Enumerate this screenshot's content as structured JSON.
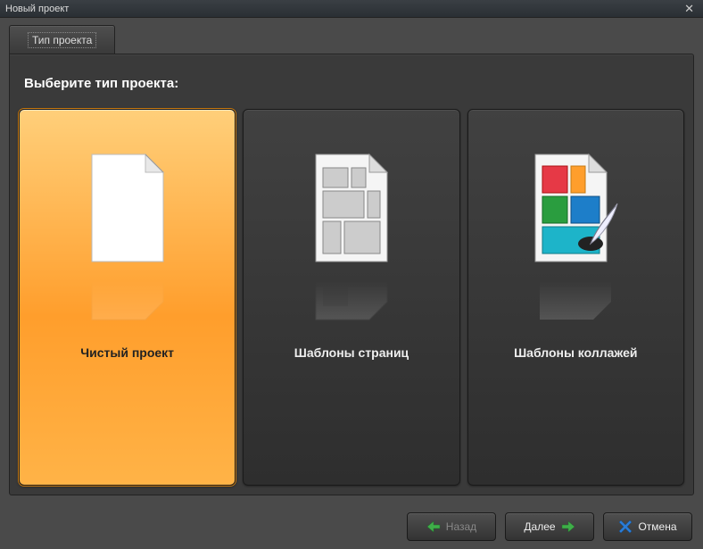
{
  "window": {
    "title": "Новый проект"
  },
  "tab": {
    "label": "Тип проекта"
  },
  "prompt": "Выберите тип проекта:",
  "options": [
    {
      "label": "Чистый проект",
      "selected": true
    },
    {
      "label": "Шаблоны страниц",
      "selected": false
    },
    {
      "label": "Шаблоны коллажей",
      "selected": false
    }
  ],
  "footer": {
    "back": "Назад",
    "next": "Далее",
    "cancel": "Отмена"
  }
}
